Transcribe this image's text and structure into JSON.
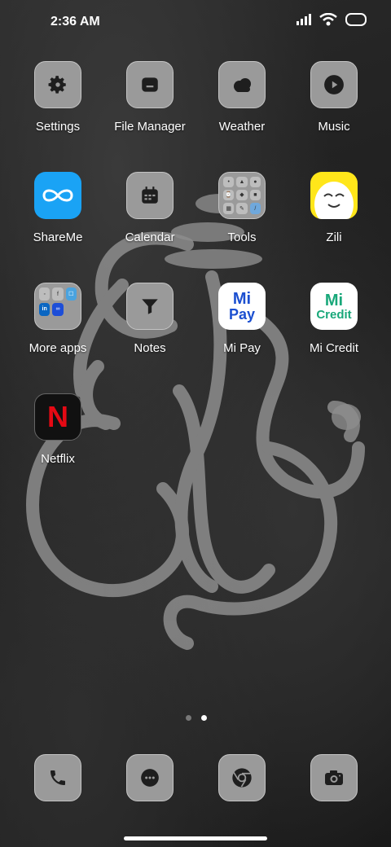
{
  "status_bar": {
    "time": "2:36 AM",
    "icons": [
      "signal-icon",
      "wifi-icon",
      "battery-icon"
    ]
  },
  "apps": [
    {
      "label": "Settings",
      "icon": "gear-icon"
    },
    {
      "label": "File Manager",
      "icon": "folder-icon"
    },
    {
      "label": "Weather",
      "icon": "cloud-icon"
    },
    {
      "label": "Music",
      "icon": "play-icon"
    },
    {
      "label": "ShareMe",
      "icon": "infinity-icon"
    },
    {
      "label": "Calendar",
      "icon": "calendar-icon"
    },
    {
      "label": "Tools",
      "icon": "tools-folder-icon"
    },
    {
      "label": "Zili",
      "icon": "zili-face-icon"
    },
    {
      "label": "More apps",
      "icon": "apps-folder-icon"
    },
    {
      "label": "Notes",
      "icon": "funnel-icon"
    },
    {
      "label": "Mi Pay",
      "icon": "mi-pay-logo",
      "logo_text": [
        "Mi",
        "Pay"
      ]
    },
    {
      "label": "Mi Credit",
      "icon": "mi-credit-logo",
      "logo_text": [
        "Mi",
        "Credit"
      ]
    },
    {
      "label": "Netflix",
      "icon": "netflix-logo",
      "logo_text": "N"
    }
  ],
  "pages": {
    "count": 2,
    "active": 2
  },
  "dock": [
    {
      "name": "phone",
      "icon": "phone-icon"
    },
    {
      "name": "messages",
      "icon": "chat-icon"
    },
    {
      "name": "browser",
      "icon": "chrome-icon"
    },
    {
      "name": "camera",
      "icon": "camera-icon"
    }
  ],
  "colors": {
    "shareme": "#1aa3f5",
    "zili": "#ffe61a",
    "mi_blue": "#1b4fd0",
    "mi_green": "#19a87a",
    "netflix_red": "#e50914"
  }
}
